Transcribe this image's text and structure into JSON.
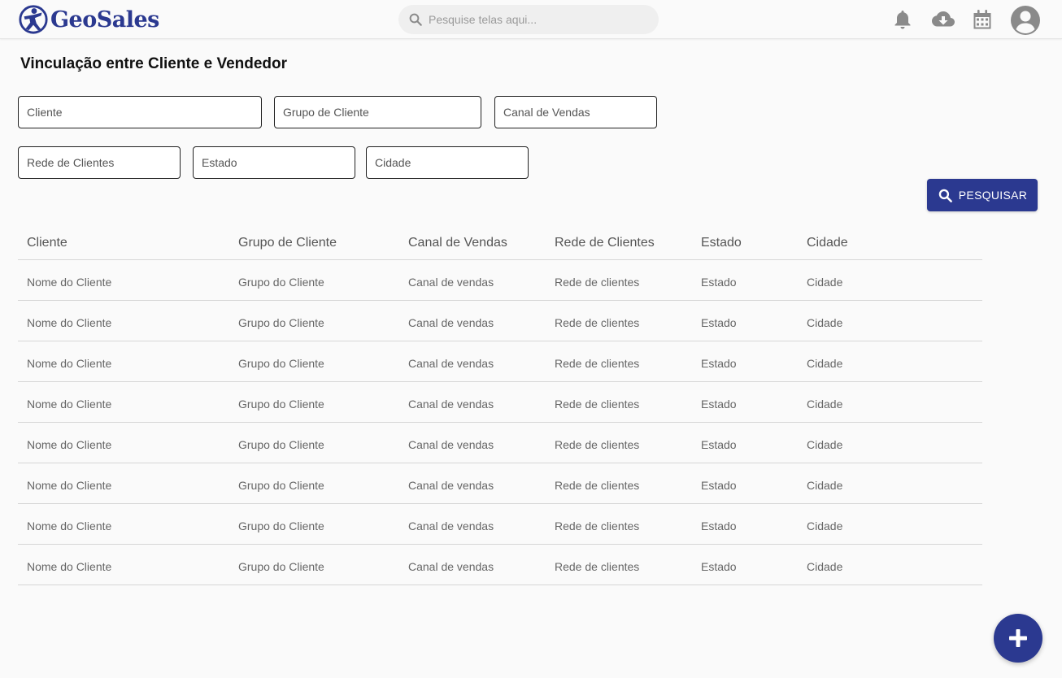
{
  "app": {
    "brand": "GeoSales",
    "accent": "#2b3990"
  },
  "search": {
    "placeholder": "Pesquise telas aqui..."
  },
  "topbar": {
    "icons": [
      "bell-icon",
      "cloud-download-icon",
      "calendar-icon",
      "avatar"
    ]
  },
  "page": {
    "title": "Vinculação entre Cliente e Vendedor"
  },
  "filters": {
    "cliente": "Cliente",
    "grupo": "Grupo de Cliente",
    "canal": "Canal de Vendas",
    "rede": "Rede de Clientes",
    "estado": "Estado",
    "cidade": "Cidade"
  },
  "search_button": {
    "label": "PESQUISAR"
  },
  "table": {
    "headers": [
      "Cliente",
      "Grupo de Cliente",
      "Canal de Vendas",
      "Rede de Clientes",
      "Estado",
      "Cidade"
    ],
    "rows": [
      [
        "Nome do Cliente",
        "Grupo do Cliente",
        "Canal de vendas",
        "Rede de clientes",
        "Estado",
        "Cidade"
      ],
      [
        "Nome do Cliente",
        "Grupo do Cliente",
        "Canal de vendas",
        "Rede de clientes",
        "Estado",
        "Cidade"
      ],
      [
        "Nome do Cliente",
        "Grupo do Cliente",
        "Canal de vendas",
        "Rede de clientes",
        "Estado",
        "Cidade"
      ],
      [
        "Nome do Cliente",
        "Grupo do Cliente",
        "Canal de vendas",
        "Rede de clientes",
        "Estado",
        "Cidade"
      ],
      [
        "Nome do Cliente",
        "Grupo do Cliente",
        "Canal de vendas",
        "Rede de clientes",
        "Estado",
        "Cidade"
      ],
      [
        "Nome do Cliente",
        "Grupo do Cliente",
        "Canal de vendas",
        "Rede de clientes",
        "Estado",
        "Cidade"
      ],
      [
        "Nome do Cliente",
        "Grupo do Cliente",
        "Canal de vendas",
        "Rede de clientes",
        "Estado",
        "Cidade"
      ],
      [
        "Nome do Cliente",
        "Grupo do Cliente",
        "Canal de vendas",
        "Rede de clientes",
        "Estado",
        "Cidade"
      ]
    ]
  },
  "fab": {
    "icon": "plus-icon"
  }
}
